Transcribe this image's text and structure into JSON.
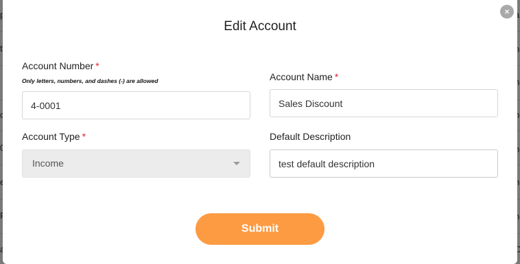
{
  "modal": {
    "title": "Edit Account",
    "close_symbol": "×",
    "close_icon": "close-icon"
  },
  "form": {
    "account_number": {
      "label": "Account Number",
      "required_mark": "*",
      "hint": "Only letters, numbers, and dashes (-) are allowed",
      "value": "4-0001"
    },
    "account_name": {
      "label": "Account Name",
      "required_mark": "*",
      "value": "Sales Discount"
    },
    "account_type": {
      "label": "Account Type",
      "required_mark": "*",
      "selected": "Income",
      "disabled": true
    },
    "default_description": {
      "label": "Default Description",
      "value": "test default description"
    },
    "submit_label": "Submit"
  },
  "colors": {
    "accent": "#fd9b43",
    "required": "#e0202a",
    "disabled_bg": "#ececec",
    "overlay": "#7a7a7a"
  },
  "background_edges": {
    "left": [
      "p",
      "t",
      "c",
      "0",
      "e",
      "Fi",
      "a"
    ],
    "right": [
      "a",
      "ne",
      "ne",
      "ne",
      "ne",
      "ne",
      "ne",
      "C"
    ]
  }
}
